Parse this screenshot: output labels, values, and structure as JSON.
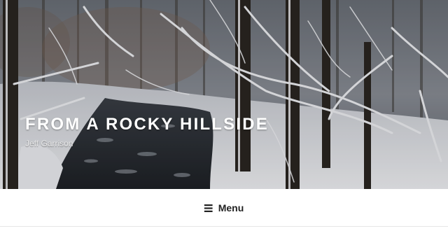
{
  "site": {
    "title": "FROM A ROCKY HILLSIDE",
    "description": "Jeff Garrison"
  },
  "header_image": {
    "subject": "snow-covered forest with a creek",
    "icon": "header-photo"
  },
  "navigation": {
    "menu_label": "Menu",
    "menu_icon": "hamburger-icon"
  },
  "colors": {
    "title_text": "#ffffff",
    "nav_background": "#ffffff",
    "nav_text": "#222222",
    "nav_border": "#e6e6e6"
  }
}
